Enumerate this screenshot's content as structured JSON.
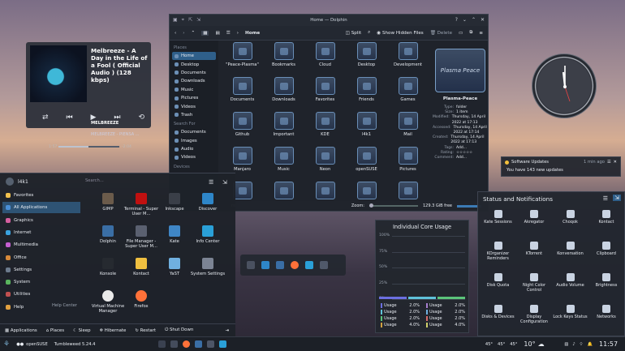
{
  "media": {
    "title": "Melbreeze - A Day in the Life of a Fool ( Official Audio ) (128 kbps)",
    "artist": "MELBREEZE",
    "album": "MELBREEZE - PIENSA ...",
    "elapsed": "1:57",
    "remaining": "-2:04",
    "progress": 0.49
  },
  "dolphin": {
    "window_title": "Home — Dolphin",
    "breadcrumb": "Home",
    "split_label": "Split",
    "hidden_files_label": "Show Hidden Files",
    "delete_label": "Delete",
    "places_header": "Places",
    "places": [
      "Home",
      "Desktop",
      "Documents",
      "Downloads",
      "Music",
      "Pictures",
      "Videos",
      "Trash"
    ],
    "search_header": "Search For",
    "search_items": [
      "Documents",
      "Images",
      "Audio",
      "Videos"
    ],
    "devices_header": "Devices",
    "files": [
      "\"Peace-Plasma\"",
      "Bookmarks",
      "Cloud",
      "Desktop",
      "Development",
      "Documents",
      "Downloads",
      "Favorites",
      "Friends",
      "Games",
      "Github",
      "Important",
      "KDE",
      "l4k1",
      "Mail",
      "Manjaro",
      "Music",
      "Neon",
      "openSUSE",
      "Pictures",
      "Plasma",
      "Plasma-Peace",
      "Reddit",
      "Templates",
      "Videos"
    ],
    "info": {
      "preview_text": "Plasma Peace",
      "name": "Plasma-Peace",
      "rows": [
        {
          "k": "Type:",
          "v": "folder"
        },
        {
          "k": "Size:",
          "v": "1 item"
        },
        {
          "k": "Modified:",
          "v": "Thursday, 14 April 2022 at 17:13"
        },
        {
          "k": "Accessed:",
          "v": "Thursday, 14 April 2022 at 17:14"
        },
        {
          "k": "Created:",
          "v": "Thursday, 14 April 2022 at 17:13"
        },
        {
          "k": "Tags:",
          "v": "Add..."
        },
        {
          "k": "Rating:",
          "v": "☆☆☆☆☆"
        },
        {
          "k": "Comment:",
          "v": "Add..."
        }
      ]
    },
    "status_left": "rs",
    "zoom_label": "Zoom:",
    "free_space": "129.3 GiB free"
  },
  "launcher": {
    "user": "l4k1",
    "search_placeholder": "Search...",
    "categories": [
      "Favorites",
      "All Applications",
      "Graphics",
      "Internet",
      "Multimedia",
      "Office",
      "Settings",
      "System",
      "Utilities",
      "Help"
    ],
    "help_center": "Help Center",
    "apps": [
      "GIMP",
      "Terminal - Super User M...",
      "Inkscape",
      "Discover",
      "Dolphin",
      "File Manager - Super User M...",
      "Kate",
      "Info Center",
      "Konsole",
      "Kontact",
      "YaST",
      "System Settings",
      "Virtual Machine Manager",
      "Firefox"
    ],
    "footer": [
      "Applications",
      "Places",
      "Sleep",
      "Hibernate",
      "Restart",
      "Shut Down"
    ]
  },
  "cores": {
    "title": "Individual Core Usage",
    "yticks": [
      "100%",
      "75%",
      "50%",
      "25%",
      "0%"
    ],
    "rows": [
      {
        "l": "Usage",
        "lv": "2.0%",
        "r": "Usage",
        "rv": "2.0%"
      },
      {
        "l": "Usage",
        "lv": "2.0%",
        "r": "Usage",
        "rv": "2.0%"
      },
      {
        "l": "Usage",
        "lv": "2.0%",
        "r": "Usage",
        "rv": "2.0%"
      },
      {
        "l": "Usage",
        "lv": "4.0%",
        "r": "Usage",
        "rv": "4.0%"
      }
    ]
  },
  "notification": {
    "app": "Software Updates",
    "time": "1 min ago",
    "body": "You have 143 new updates"
  },
  "status": {
    "title": "Status and Notifications",
    "items": [
      "Kate Sessions",
      "Akregator",
      "Choqok",
      "Kontact",
      "KOrganizer Reminders",
      "KTorrent",
      "Konversation",
      "Clipboard",
      "Disk Quota",
      "Night Color Control",
      "Audio Volume",
      "Brightness",
      "Disks & Devices",
      "Display Configuration",
      "Lock Keys Status",
      "Networks"
    ]
  },
  "taskbar": {
    "distro": "openSUSE",
    "version": "Tumbleweed 5.24.4",
    "temps": [
      "45°",
      "45°",
      "45°"
    ],
    "weather": "10°",
    "clock": "11:57"
  },
  "colors": {
    "accent": "#2f5f8a",
    "firefox": "#ff7139",
    "terminal": "#c01010"
  }
}
